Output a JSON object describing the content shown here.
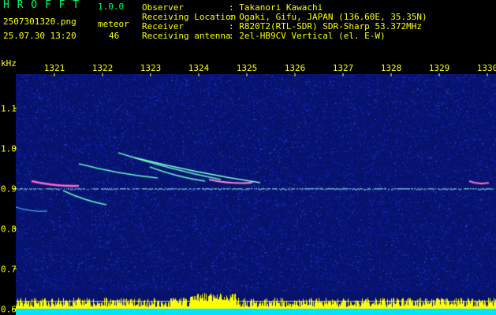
{
  "header": {
    "app_name": "H R O F F T",
    "version": "1.0.0",
    "filename": "2507301320.png",
    "datetime": "25.07.30 13:20",
    "count_label": "meteor",
    "count_value": "46",
    "info": [
      {
        "label": "Observer",
        "value": ": Takanori Kawachi"
      },
      {
        "label": "Receiving Location",
        "value": ": Ogaki, Gifu, JAPAN (136.60E, 35.35N)"
      },
      {
        "label": "Receiver",
        "value": ": R820T2(RTL-SDR) SDR-Sharp 53.372MHz"
      },
      {
        "label": "Receiving antenna",
        "value": ": 2el-HB9CV Vertical (el. E-W)"
      }
    ]
  },
  "chart_data": {
    "type": "heatmap",
    "xlabel": "",
    "ylabel": "kHz",
    "x_ticks": [
      "1321",
      "1322",
      "1323",
      "1324",
      "1325",
      "1326",
      "1327",
      "1328",
      "1329",
      "1330"
    ],
    "y_ticks": [
      "1.1",
      "1.0",
      "0.9",
      "0.8",
      "0.7",
      "0.6"
    ],
    "y_range_khz": [
      0.585,
      1.185
    ],
    "carrier_khz": 0.9,
    "colors": {
      "background": "#06126b",
      "noise": "#1d2fd0",
      "signal": "#9fffff",
      "hot": "#ff60c0",
      "bars_yellow": "#ffff00",
      "bars_cyan": "#00e5ff",
      "axis": "#ffff00"
    }
  }
}
